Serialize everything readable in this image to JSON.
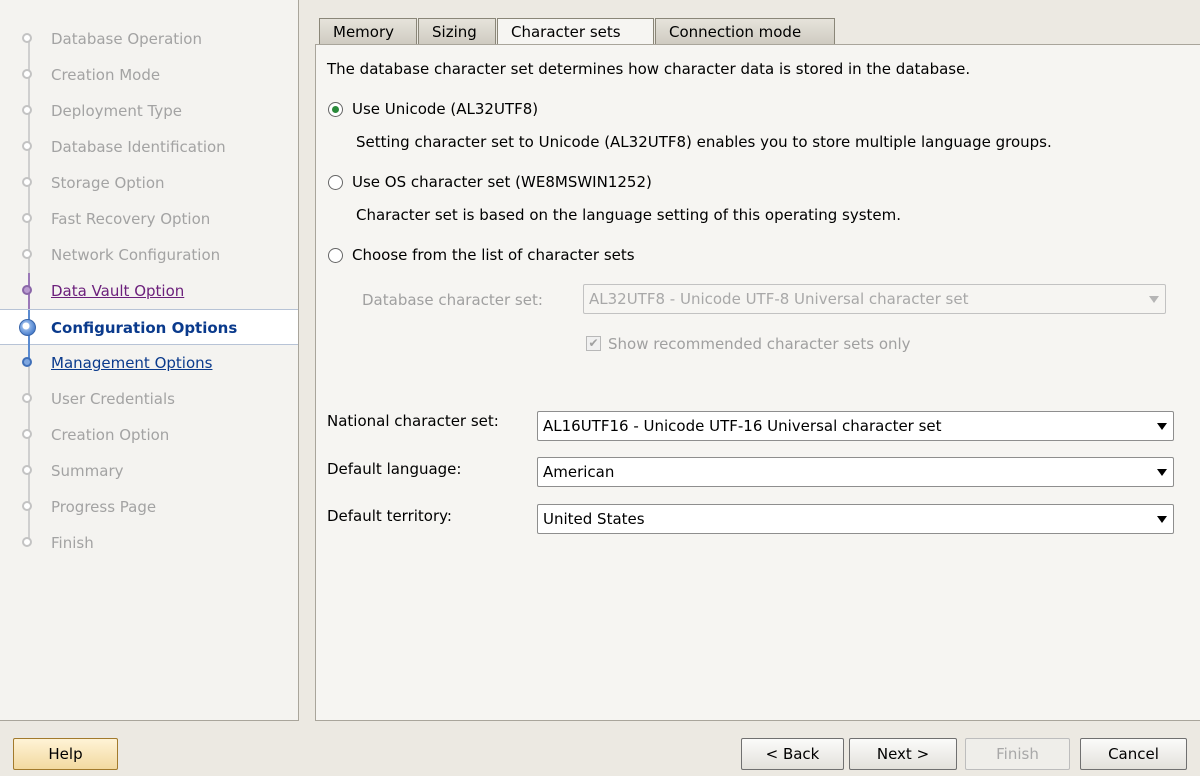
{
  "steps": [
    {
      "label": "Database Operation",
      "state": "done"
    },
    {
      "label": "Creation Mode",
      "state": "done"
    },
    {
      "label": "Deployment Type",
      "state": "done"
    },
    {
      "label": "Database Identification",
      "state": "done"
    },
    {
      "label": "Storage Option",
      "state": "done"
    },
    {
      "label": "Fast Recovery Option",
      "state": "done"
    },
    {
      "label": "Network Configuration",
      "state": "done"
    },
    {
      "label": "Data Vault Option",
      "state": "visited"
    },
    {
      "label": "Configuration Options",
      "state": "active"
    },
    {
      "label": "Management Options",
      "state": "next"
    },
    {
      "label": "User Credentials",
      "state": "pending"
    },
    {
      "label": "Creation Option",
      "state": "pending"
    },
    {
      "label": "Summary",
      "state": "pending"
    },
    {
      "label": "Progress Page",
      "state": "pending"
    },
    {
      "label": "Finish",
      "state": "pending"
    }
  ],
  "tabs": [
    {
      "label": "Memory",
      "selected": false
    },
    {
      "label": "Sizing",
      "selected": false
    },
    {
      "label": "Character sets",
      "selected": true
    },
    {
      "label": "Connection mode",
      "selected": false
    }
  ],
  "charset": {
    "intro": "The database character set determines how character data is stored in the database.",
    "unicode_label": "Use Unicode (AL32UTF8)",
    "unicode_desc": "Setting character set to Unicode (AL32UTF8) enables you to store multiple language groups.",
    "os_label": "Use OS character set (WE8MSWIN1252)",
    "os_desc": "Character set is based on the language setting of this operating system.",
    "choose_label": "Choose from the list of character sets",
    "db_charset_label": "Database character set:",
    "db_charset_value": "AL32UTF8 - Unicode UTF-8 Universal character set",
    "recommended_label": "Show recommended character sets only",
    "recommended_checked": true,
    "selected_option": "unicode"
  },
  "national": {
    "label": "National character set:",
    "value": "AL16UTF16 - Unicode UTF-16 Universal character set"
  },
  "language": {
    "label": "Default language:",
    "value": "American"
  },
  "territory": {
    "label": "Default territory:",
    "value": "United States"
  },
  "buttons": {
    "help": "Help",
    "back": "< Back",
    "next": "Next >",
    "finish": "Finish",
    "cancel": "Cancel"
  }
}
